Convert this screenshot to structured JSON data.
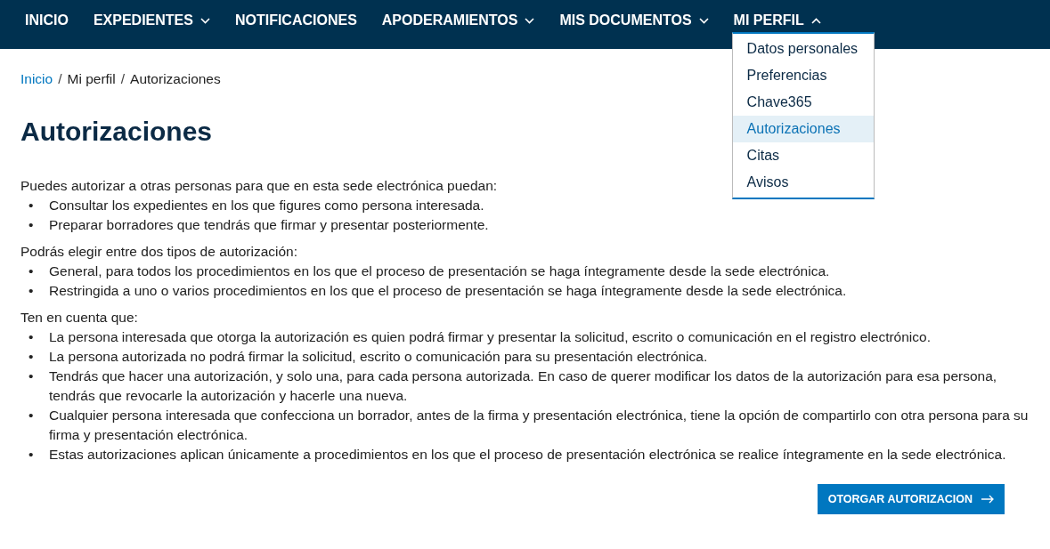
{
  "nav": [
    {
      "label": "INICIO",
      "kind": "link"
    },
    {
      "label": "EXPEDIENTES",
      "kind": "dropdown",
      "expanded": false
    },
    {
      "label": "NOTIFICACIONES",
      "kind": "link"
    },
    {
      "label": "APODERAMIENTOS",
      "kind": "dropdown",
      "expanded": false
    },
    {
      "label": "MIS DOCUMENTOS",
      "kind": "dropdown",
      "expanded": false
    },
    {
      "label": "MI PERFIL",
      "kind": "dropdown",
      "expanded": true,
      "menu": [
        {
          "label": "Datos personales",
          "selected": false
        },
        {
          "label": "Preferencias",
          "selected": false
        },
        {
          "label": "Chave365",
          "selected": false
        },
        {
          "label": "Autorizaciones",
          "selected": true
        },
        {
          "label": "Citas",
          "selected": false
        },
        {
          "label": "Avisos",
          "selected": false
        }
      ]
    }
  ],
  "breadcrumb": [
    {
      "kind": "link",
      "text": "Inicio"
    },
    {
      "kind": "separator",
      "text": "/"
    },
    {
      "kind": "text",
      "text": "Mi perfil"
    },
    {
      "kind": "separator",
      "text": "/"
    },
    {
      "kind": "text",
      "text": "Autorizaciones"
    }
  ],
  "title": "Autorizaciones",
  "sections": [
    {
      "intro": "Puedes autorizar a otras personas para que en esta sede electrónica puedan:",
      "items": [
        {
          "marker": "•",
          "text": "Consultar los expedientes en los que figures como persona interesada."
        },
        {
          "marker": "•",
          "text": "Preparar borradores que tendrás que firmar y presentar posteriormente."
        }
      ]
    },
    {
      "intro": "Podrás elegir entre dos tipos de autorización:",
      "items": [
        {
          "marker": "•",
          "text": "General, para todos los procedimientos en los que el proceso de presentación se haga íntegramente desde la sede electrónica."
        },
        {
          "marker": "•",
          "text": "Restringida a uno o varios procedimientos en los que el proceso de presentación se haga íntegramente desde la sede electrónica."
        }
      ]
    },
    {
      "intro": "Ten en cuenta que:",
      "items": [
        {
          "marker": "•",
          "text": "La persona interesada que otorga la autorización es quien podrá firmar y presentar la solicitud, escrito o comunicación en el registro electrónico."
        },
        {
          "marker": "•",
          "text": "La persona autorizada no podrá firmar la solicitud, escrito o comunicación para su presentación electrónica."
        },
        {
          "marker": "•",
          "text": "Tendrás que hacer una autorización, y solo una, para cada persona autorizada. En caso de querer modificar los datos de la autorización para esa persona, tendrás que revocarle la autorización y hacerle una nueva."
        },
        {
          "marker": "•",
          "text": "Cualquier persona interesada que confecciona un borrador, antes de la firma y presentación electrónica, tiene la opción de compartirlo con otra persona para su firma y presentación electrónica."
        },
        {
          "marker": "•",
          "text": "Estas autorizaciones aplican únicamente a procedimientos en los que el proceso de presentación electrónica se realice íntegramente en la sede electrónica."
        }
      ]
    }
  ],
  "action_button": "OTORGAR AUTORIZACION"
}
